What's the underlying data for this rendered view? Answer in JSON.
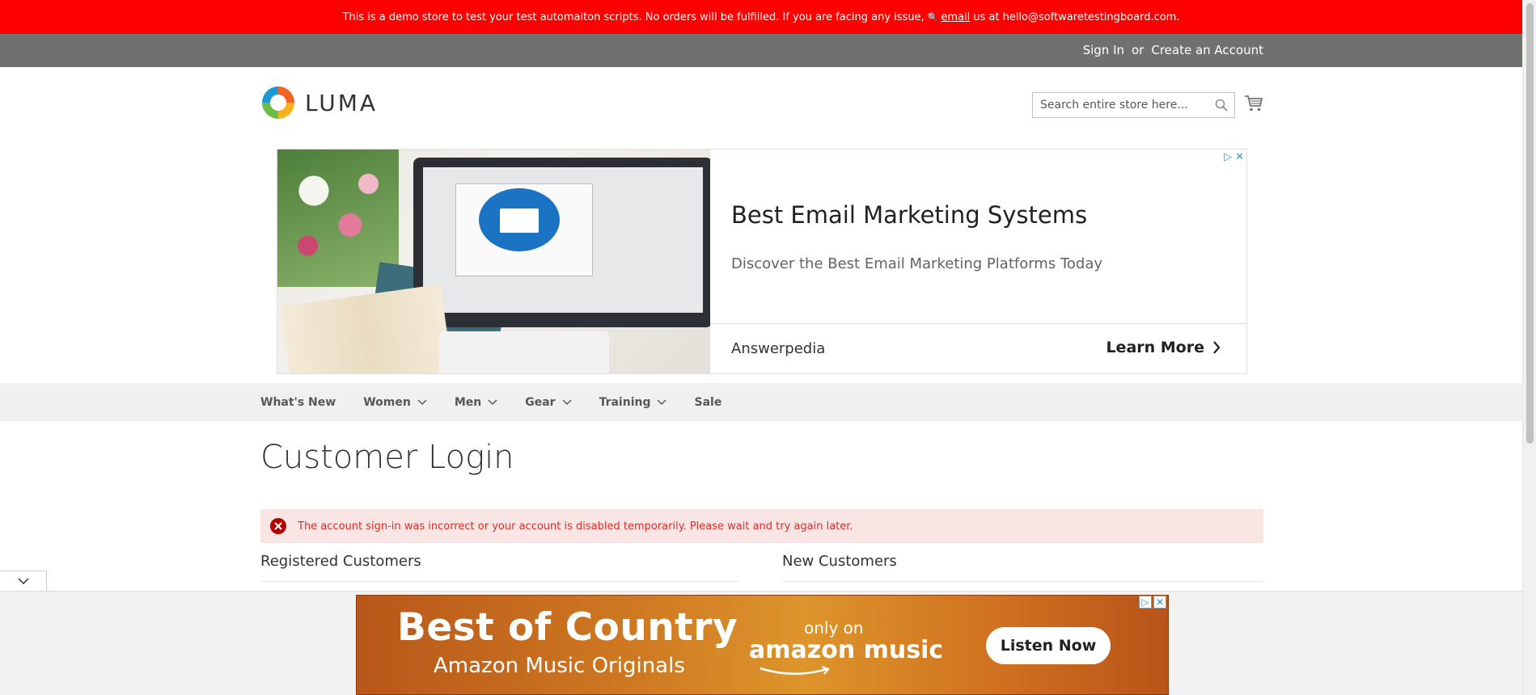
{
  "demo_notice": {
    "text_before": "This is a demo store to test your test automaiton scripts. No orders will be fulfilled. If you are facing any issue,",
    "link": "email",
    "text_after": "us at hello@softwaretestingboard.com."
  },
  "header": {
    "sign_in": "Sign In",
    "or": "or",
    "create_account": "Create an Account",
    "logo_text": "LUMA",
    "search_placeholder": "Search entire store here..."
  },
  "top_ad": {
    "title": "Best Email Marketing Systems",
    "subtitle": "Discover the Best Email Marketing Platforms Today",
    "brand": "Answerpedia",
    "cta": "Learn More"
  },
  "nav": {
    "items": [
      {
        "label": "What's New",
        "has_menu": false
      },
      {
        "label": "Women",
        "has_menu": true
      },
      {
        "label": "Men",
        "has_menu": true
      },
      {
        "label": "Gear",
        "has_menu": true
      },
      {
        "label": "Training",
        "has_menu": true
      },
      {
        "label": "Sale",
        "has_menu": false
      }
    ]
  },
  "main": {
    "page_title": "Customer Login",
    "error_message": "The account sign-in was incorrect or your account is disabled temporarily. Please wait and try again later.",
    "registered_title": "Registered Customers",
    "new_title": "New Customers"
  },
  "bottom_ad": {
    "title": "Best of Country",
    "subtitle": "Amazon Music Originals",
    "only_on": "only on",
    "brand": "amazon music",
    "cta": "Listen Now"
  },
  "colors": {
    "demo_bar": "#ff0000",
    "panel_bar": "#6e716e",
    "error_bg": "#fae5e5",
    "error_text": "#e02b27",
    "nav_bg": "#f0f0f0"
  }
}
